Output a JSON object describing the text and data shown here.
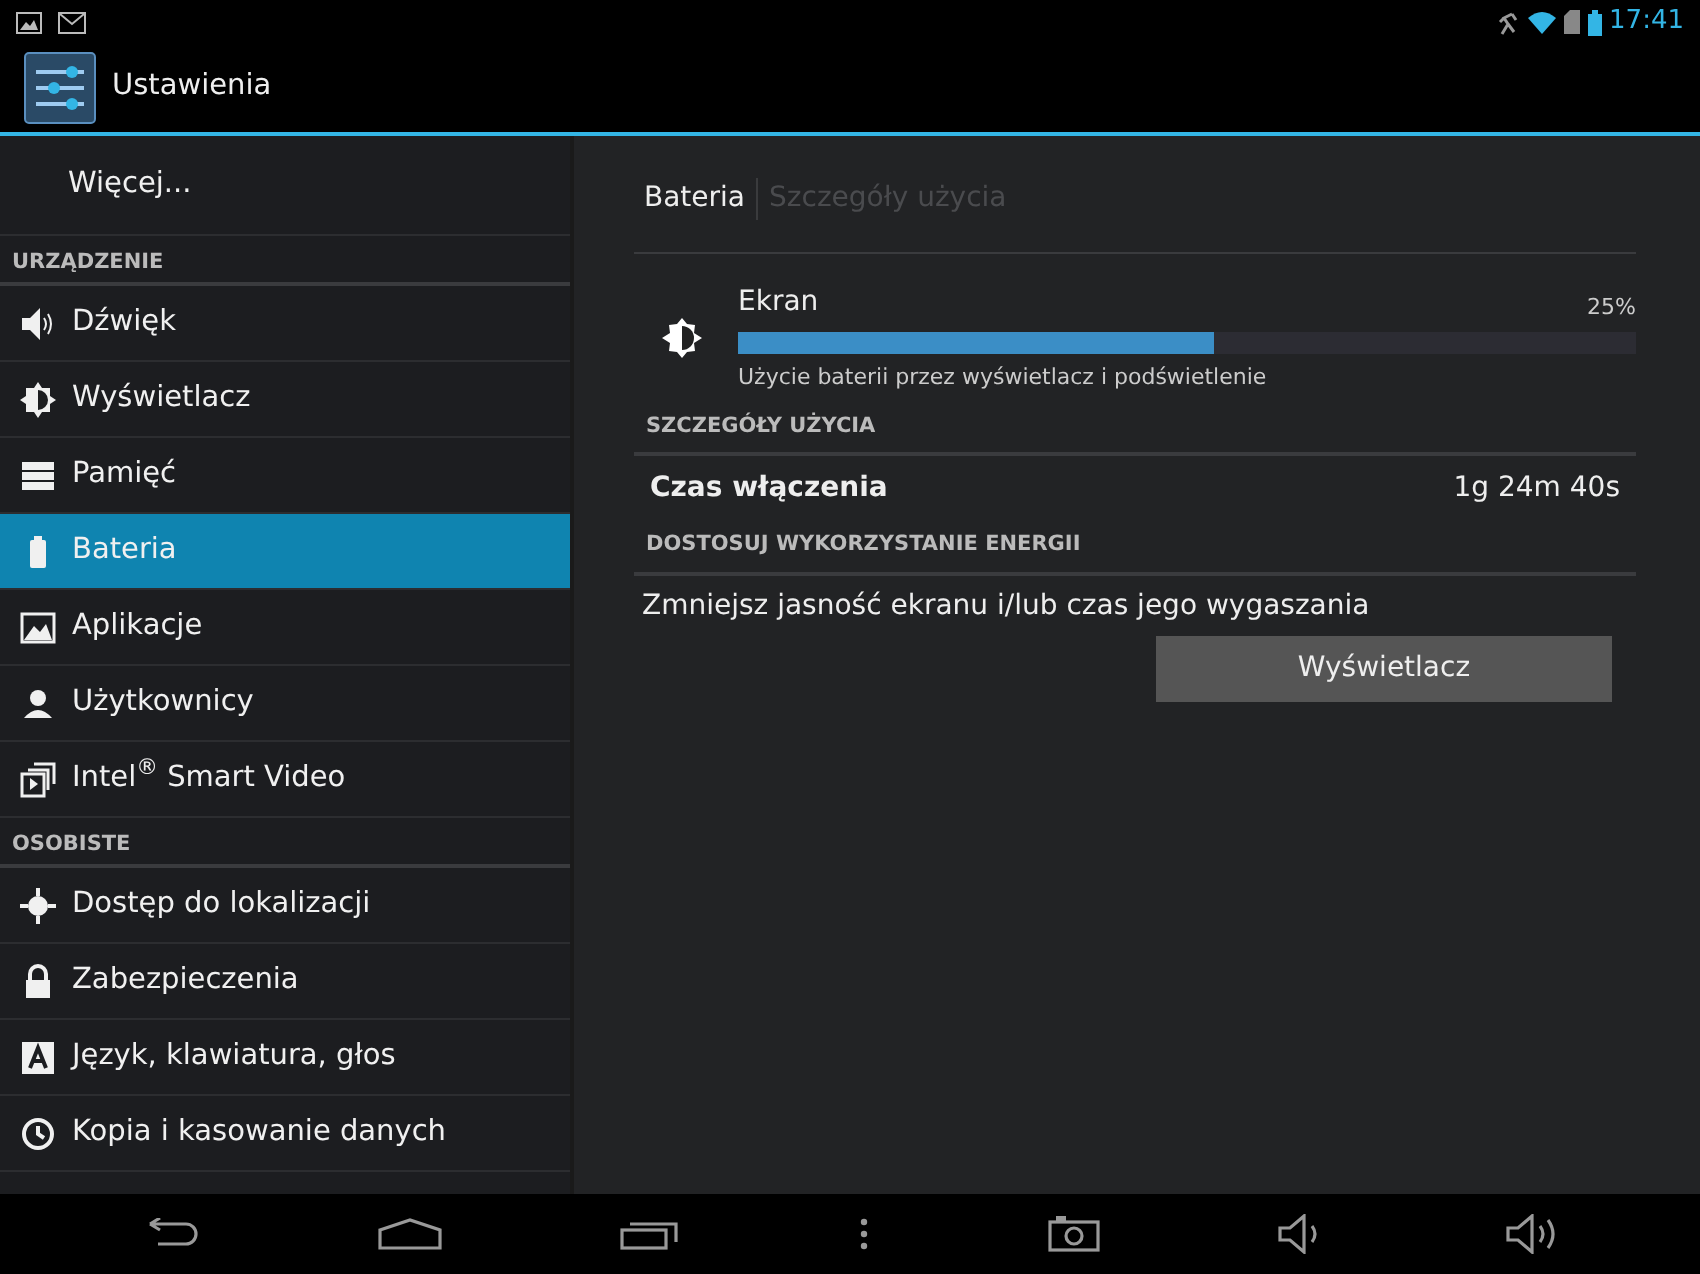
{
  "status_bar": {
    "time": "17:41"
  },
  "action_bar": {
    "title": "Ustawienia"
  },
  "sidebar": {
    "items": [
      {
        "kind": "item",
        "label": "Więcej...",
        "selected": false
      },
      {
        "kind": "header",
        "label": "URZĄDZENIE"
      },
      {
        "kind": "item",
        "label": "Dźwięk",
        "selected": false
      },
      {
        "kind": "item",
        "label": "Wyświetlacz",
        "selected": false
      },
      {
        "kind": "item",
        "label": "Pamięć",
        "selected": false
      },
      {
        "kind": "item",
        "label": "Bateria",
        "selected": true
      },
      {
        "kind": "item",
        "label": "Aplikacje",
        "selected": false
      },
      {
        "kind": "item",
        "label": "Użytkownicy",
        "selected": false
      },
      {
        "kind": "item",
        "label": "Intel$^{®}$ Smart Video",
        "selected": false
      },
      {
        "kind": "header",
        "label": "OSOBISTE"
      },
      {
        "kind": "item",
        "label": "Dostęp do lokalizacji",
        "selected": false
      },
      {
        "kind": "item",
        "label": "Zabezpieczenia",
        "selected": false
      },
      {
        "kind": "item",
        "label": "Język, klawiatura, głos",
        "selected": false
      },
      {
        "kind": "item",
        "label": "Kopia i kasowanie danych",
        "selected": false
      }
    ]
  },
  "breadcrumbs": [
    {
      "label": "Bateria",
      "selected": true
    },
    {
      "label": "Szczegóły użycia",
      "selected": false
    }
  ],
  "usage": {
    "label": "Ekran",
    "percent": "25%",
    "level": 0.53,
    "description": "Użycie baterii przez wyświetlacz i podświetlenie"
  },
  "details": {
    "header": "SZCZEGÓŁY UŻYCIA",
    "rows": [
      {
        "label": "Czas włączenia",
        "value": "1g 24m 40s"
      }
    ]
  },
  "adjust": {
    "header": "DOSTOSUJ WYKORZYSTANIE ENERGII",
    "text": "Zmniejsz jasność ekranu i/lub czas jego wygaszania",
    "button": "Wyświetlacz"
  }
}
